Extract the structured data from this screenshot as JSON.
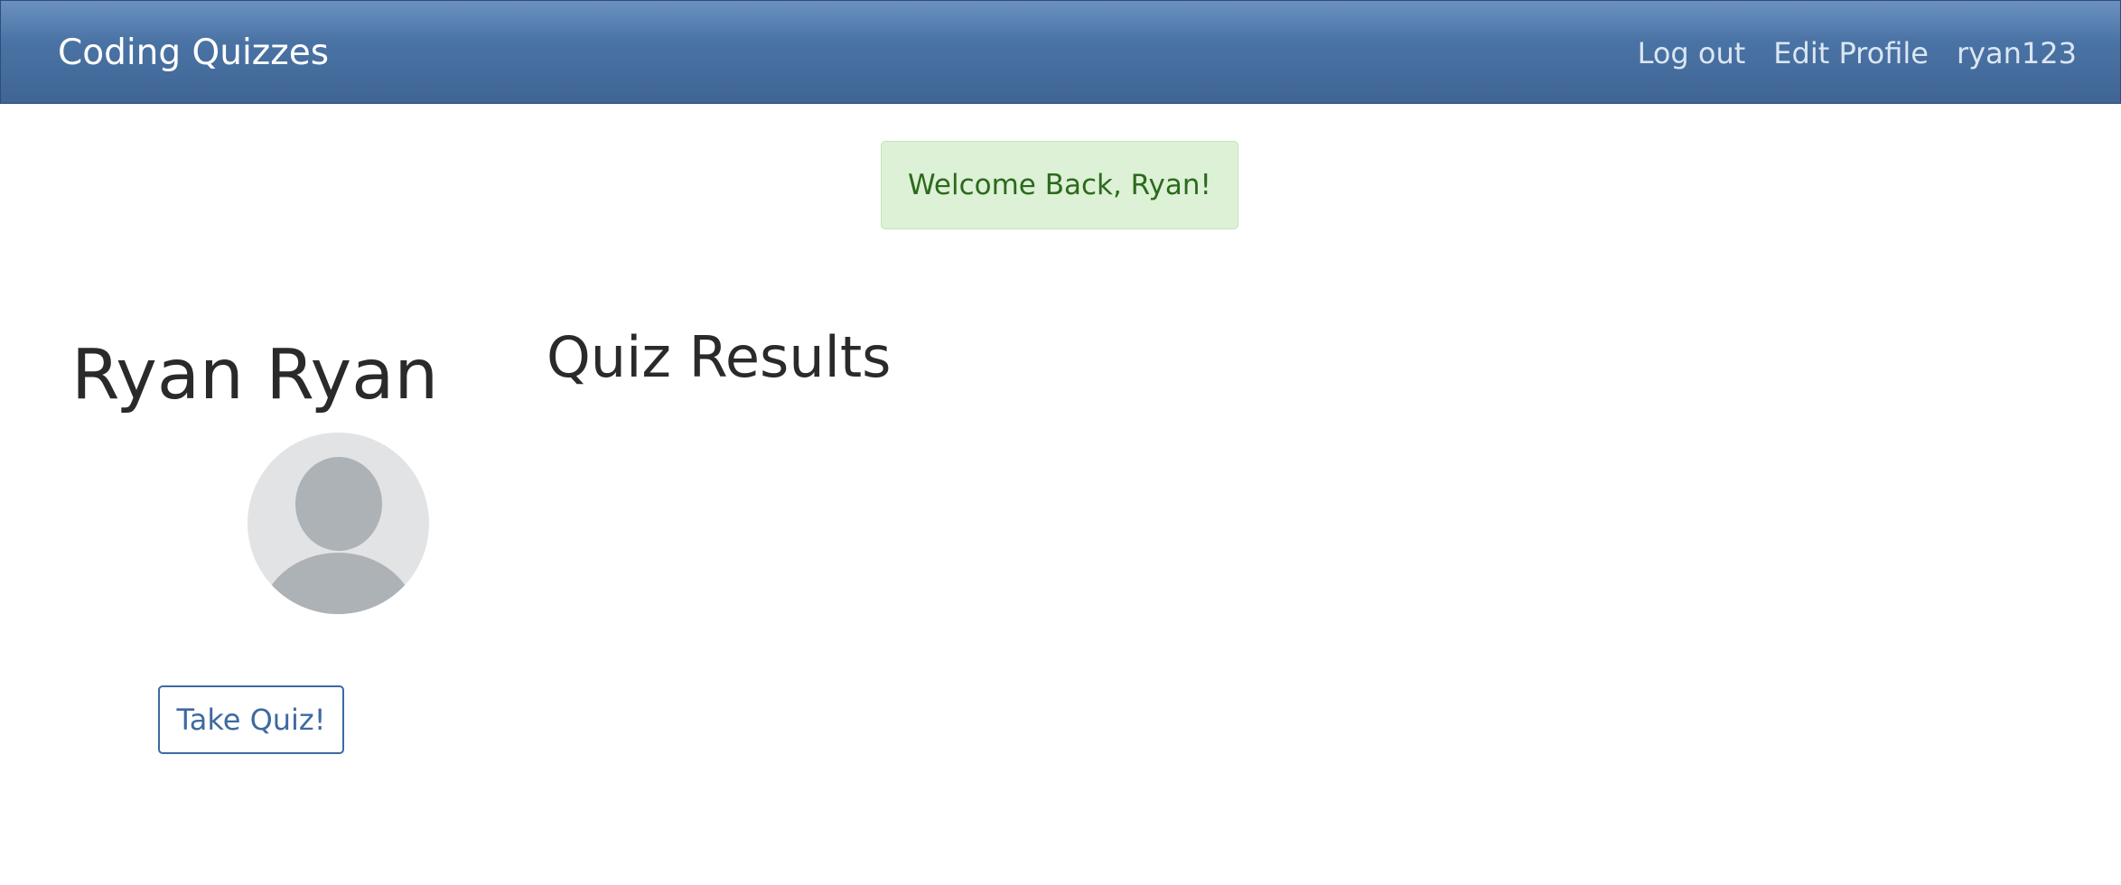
{
  "navbar": {
    "brand": "Coding Quizzes",
    "links": [
      {
        "label": "Log out"
      },
      {
        "label": "Edit Profile"
      },
      {
        "label": "ryan123"
      }
    ]
  },
  "flash": {
    "message": "Welcome Back, Ryan!",
    "type": "success"
  },
  "profile": {
    "name": "Ryan Ryan",
    "avatar": "default-user-avatar",
    "take_quiz_label": "Take Quiz!"
  },
  "results": {
    "title": "Quiz Results",
    "items": []
  },
  "colors": {
    "navbar": "#4a73a5",
    "navbar_text": "#ffffff",
    "alert_background": "#dcf1d6",
    "alert_text": "#2c6a1c",
    "button_outline": "#3e6aa0",
    "heading_text": "#2a2a2a",
    "avatar_background": "#e2e3e5",
    "avatar_figure": "#adb2b6"
  }
}
